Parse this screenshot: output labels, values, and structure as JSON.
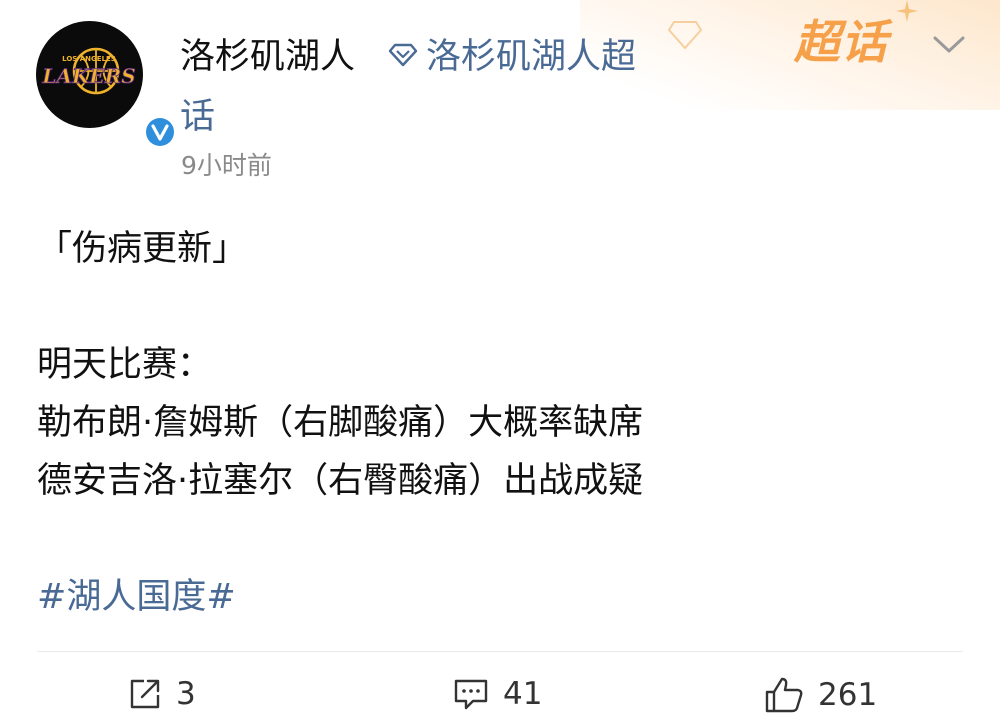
{
  "header": {
    "username": "洛杉矶湖人",
    "topic_name_line1": "洛杉矶湖人超",
    "topic_name_line2": "话",
    "timestamp": "9小时前",
    "super_topic_badge": "超话"
  },
  "post": {
    "line1": "「伤病更新」",
    "line2": "明天比赛：",
    "line3": "勒布朗·詹姆斯（右脚酸痛）大概率缺席",
    "line4": "德安吉洛·拉塞尔（右臀酸痛）出战成疑",
    "hashtag": "#湖人国度#"
  },
  "actions": {
    "repost_count": "3",
    "comment_count": "41",
    "like_count": "261"
  },
  "avatar": {
    "logo_text": "LAKERS",
    "logo_subtext": "LOS ANGELES"
  },
  "colors": {
    "link": "#4a6a96",
    "badge": "#f6a04a",
    "verified": "#2f8fdc",
    "avatar_bg": "#0b0b0b",
    "lakers_gold": "#f0b22c",
    "lakers_purple": "#552583"
  },
  "icons": [
    "diamond-icon",
    "chevron-down-icon",
    "verified-icon",
    "repost-icon",
    "comment-icon",
    "like-icon"
  ]
}
